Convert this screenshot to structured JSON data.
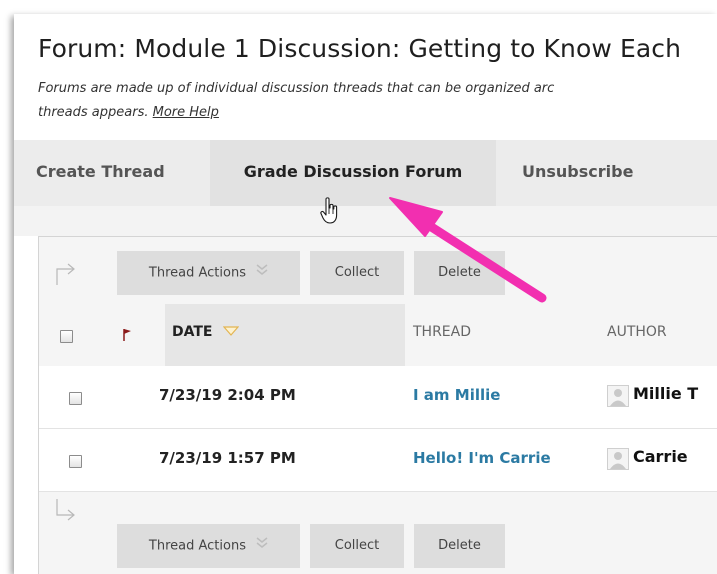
{
  "forum": {
    "title": "Forum: Module 1 Discussion: Getting to Know Each",
    "desc_line1": "Forums are made up of individual discussion threads that can be organized arc",
    "desc_line2": "threads appears. ",
    "more_help": "More Help"
  },
  "tabs": [
    {
      "label": "Create Thread"
    },
    {
      "label": "Grade Discussion Forum",
      "active": true
    },
    {
      "label": "Unsubscribe"
    }
  ],
  "toolbar": {
    "thread_actions": "Thread Actions",
    "collect": "Collect",
    "delete": "Delete"
  },
  "table": {
    "columns": [
      "DATE",
      "THREAD",
      "AUTHOR"
    ],
    "rows": [
      {
        "date": "7/23/19 2:04 PM",
        "thread": "I am Millie",
        "author": "Millie T"
      },
      {
        "date": "7/23/19 1:57 PM",
        "thread": "Hello! I'm Carrie",
        "author": "Carrie"
      }
    ]
  },
  "colors": {
    "link": "#2b7aa3",
    "annotation_arrow": "#f22fb0",
    "flag": "#8b1a1a",
    "sort_triangle": "#e3b552"
  },
  "icons": [
    "cursor-hand-icon",
    "annotation-arrow",
    "flag-icon",
    "sort-down-icon",
    "chevron-down-icon",
    "bracket-arrow-icon",
    "avatar-icon",
    "checkbox"
  ]
}
